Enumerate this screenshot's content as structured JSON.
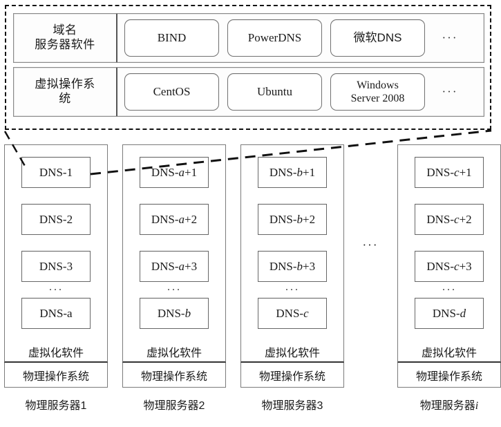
{
  "figure": {
    "title_visible": false,
    "software_stack": {
      "rows": [
        {
          "label": "域名\n服务器软件",
          "label_line1": "域名",
          "label_line2": "服务器软件",
          "items": [
            "BIND",
            "PowerDNS",
            "微软DNS"
          ],
          "ellipsis": "···"
        },
        {
          "label": "虚拟操作系统",
          "label_line1": "虚拟操作系",
          "label_line2": "统",
          "items": [
            "CentOS",
            "Ubuntu",
            "Windows Server 2008"
          ],
          "item3_line1": "Windows",
          "item3_line2": "Server 2008",
          "ellipsis": "···"
        }
      ]
    },
    "servers": [
      {
        "vms": [
          "DNS-1",
          "DNS-2",
          "DNS-3"
        ],
        "vm_ellipsis": "···",
        "vm_last": "DNS-a",
        "virtualization_label": "虚拟化软件",
        "physical_os_label": "物理操作系统",
        "caption_prefix": "物理服务器",
        "caption_index": "1"
      },
      {
        "vms": [
          "DNS-a+1",
          "DNS-a+2",
          "DNS-a+3"
        ],
        "vm_prefix": "DNS-",
        "vm_symbol": "a",
        "vm_suffixes": [
          "+1",
          "+2",
          "+3"
        ],
        "vm_ellipsis": "···",
        "vm_last": "DNS-b",
        "vm_last_symbol": "b",
        "virtualization_label": "虚拟化软件",
        "physical_os_label": "物理操作系统",
        "caption_prefix": "物理服务器",
        "caption_index": "2"
      },
      {
        "vms": [
          "DNS-b+1",
          "DNS-b+2",
          "DNS-b+3"
        ],
        "vm_prefix": "DNS-",
        "vm_symbol": "b",
        "vm_suffixes": [
          "+1",
          "+2",
          "+3"
        ],
        "vm_ellipsis": "···",
        "vm_last": "DNS-c",
        "vm_last_symbol": "c",
        "virtualization_label": "虚拟化软件",
        "physical_os_label": "物理操作系统",
        "caption_prefix": "物理服务器",
        "caption_index": "3"
      },
      {
        "vms": [
          "DNS-c+1",
          "DNS-c+2",
          "DNS-c+3"
        ],
        "vm_prefix": "DNS-",
        "vm_symbol": "c",
        "vm_suffixes": [
          "+1",
          "+2",
          "+3"
        ],
        "vm_ellipsis": "···",
        "vm_last": "DNS-d",
        "vm_last_symbol": "d",
        "virtualization_label": "虚拟化软件",
        "physical_os_label": "物理操作系统",
        "caption_prefix": "物理服务器",
        "caption_index": "i"
      }
    ],
    "between_columns_ellipsis": "···",
    "colors": {
      "stroke": "#111111",
      "box_border": "#6f6f6f",
      "thick_divider": "#333333",
      "background": "#ffffff",
      "text": "#1a1a1a"
    }
  }
}
